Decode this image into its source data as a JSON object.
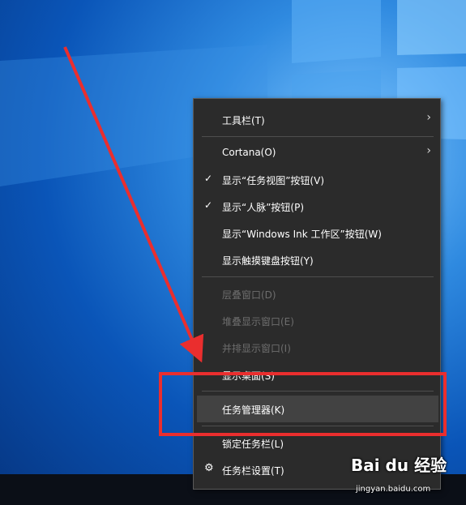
{
  "menu": {
    "items": [
      {
        "label": "工具栏(T)",
        "submenu": true
      },
      {
        "label": "Cortana(O)",
        "submenu": true
      },
      {
        "label": "显示“任务视图”按钮(V)",
        "checked": true
      },
      {
        "label": "显示“人脉”按钮(P)",
        "checked": true
      },
      {
        "label": "显示“Windows Ink 工作区”按钮(W)"
      },
      {
        "label": "显示触摸键盘按钮(Y)"
      },
      {
        "label": "层叠窗口(D)",
        "disabled": true
      },
      {
        "label": "堆叠显示窗口(E)",
        "disabled": true
      },
      {
        "label": "并排显示窗口(I)",
        "disabled": true
      },
      {
        "label": "显示桌面(S)"
      },
      {
        "label": "任务管理器(K)",
        "highlighted": true
      },
      {
        "label": "锁定任务栏(L)"
      },
      {
        "label": "任务栏设置(T)",
        "icon": "gear-icon"
      }
    ]
  },
  "icons": {
    "check": "✓",
    "chevron": "›",
    "gear": "⚙"
  },
  "watermark": {
    "brand": "Bai du 经验",
    "url": "jingyan.baidu.com"
  },
  "colors": {
    "menu_bg": "#2b2b2b",
    "highlight_bg": "#424242",
    "annotation_red": "#ea2e2e",
    "disabled_text": "#6d6d6d"
  }
}
